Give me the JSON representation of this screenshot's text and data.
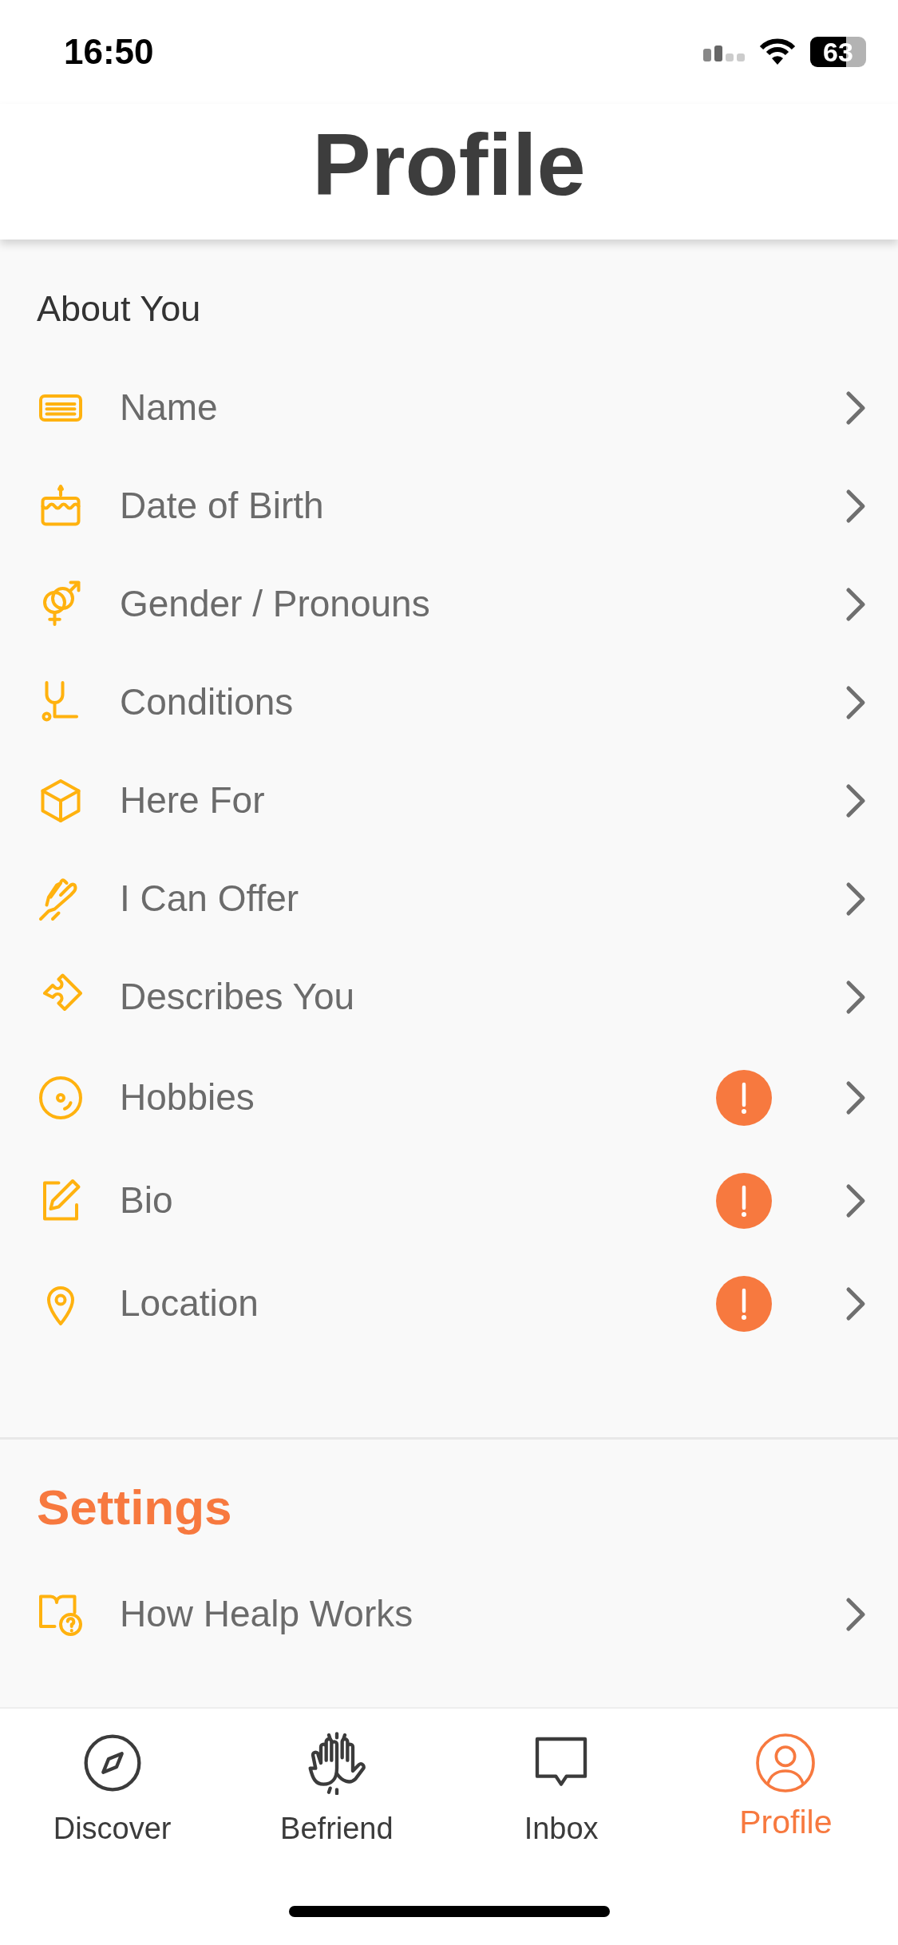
{
  "status_bar": {
    "time": "16:50",
    "battery": "63"
  },
  "header": {
    "title": "Profile"
  },
  "about": {
    "heading": "About You",
    "items": [
      {
        "label": "Name",
        "incomplete": false
      },
      {
        "label": "Date of Birth",
        "incomplete": false
      },
      {
        "label": "Gender / Pronouns",
        "incomplete": false
      },
      {
        "label": "Conditions",
        "incomplete": false
      },
      {
        "label": "Here For",
        "incomplete": false
      },
      {
        "label": "I Can Offer",
        "incomplete": false
      },
      {
        "label": "Describes You",
        "incomplete": false
      },
      {
        "label": "Hobbies",
        "incomplete": true
      },
      {
        "label": "Bio",
        "incomplete": true
      },
      {
        "label": "Location",
        "incomplete": true
      }
    ]
  },
  "settings": {
    "heading": "Settings",
    "items": [
      {
        "label": "How Healp Works"
      }
    ]
  },
  "tab_bar": [
    {
      "label": "Discover",
      "selected": false
    },
    {
      "label": "Befriend",
      "selected": false
    },
    {
      "label": "Inbox",
      "selected": false
    },
    {
      "label": "Profile",
      "selected": true
    }
  ]
}
